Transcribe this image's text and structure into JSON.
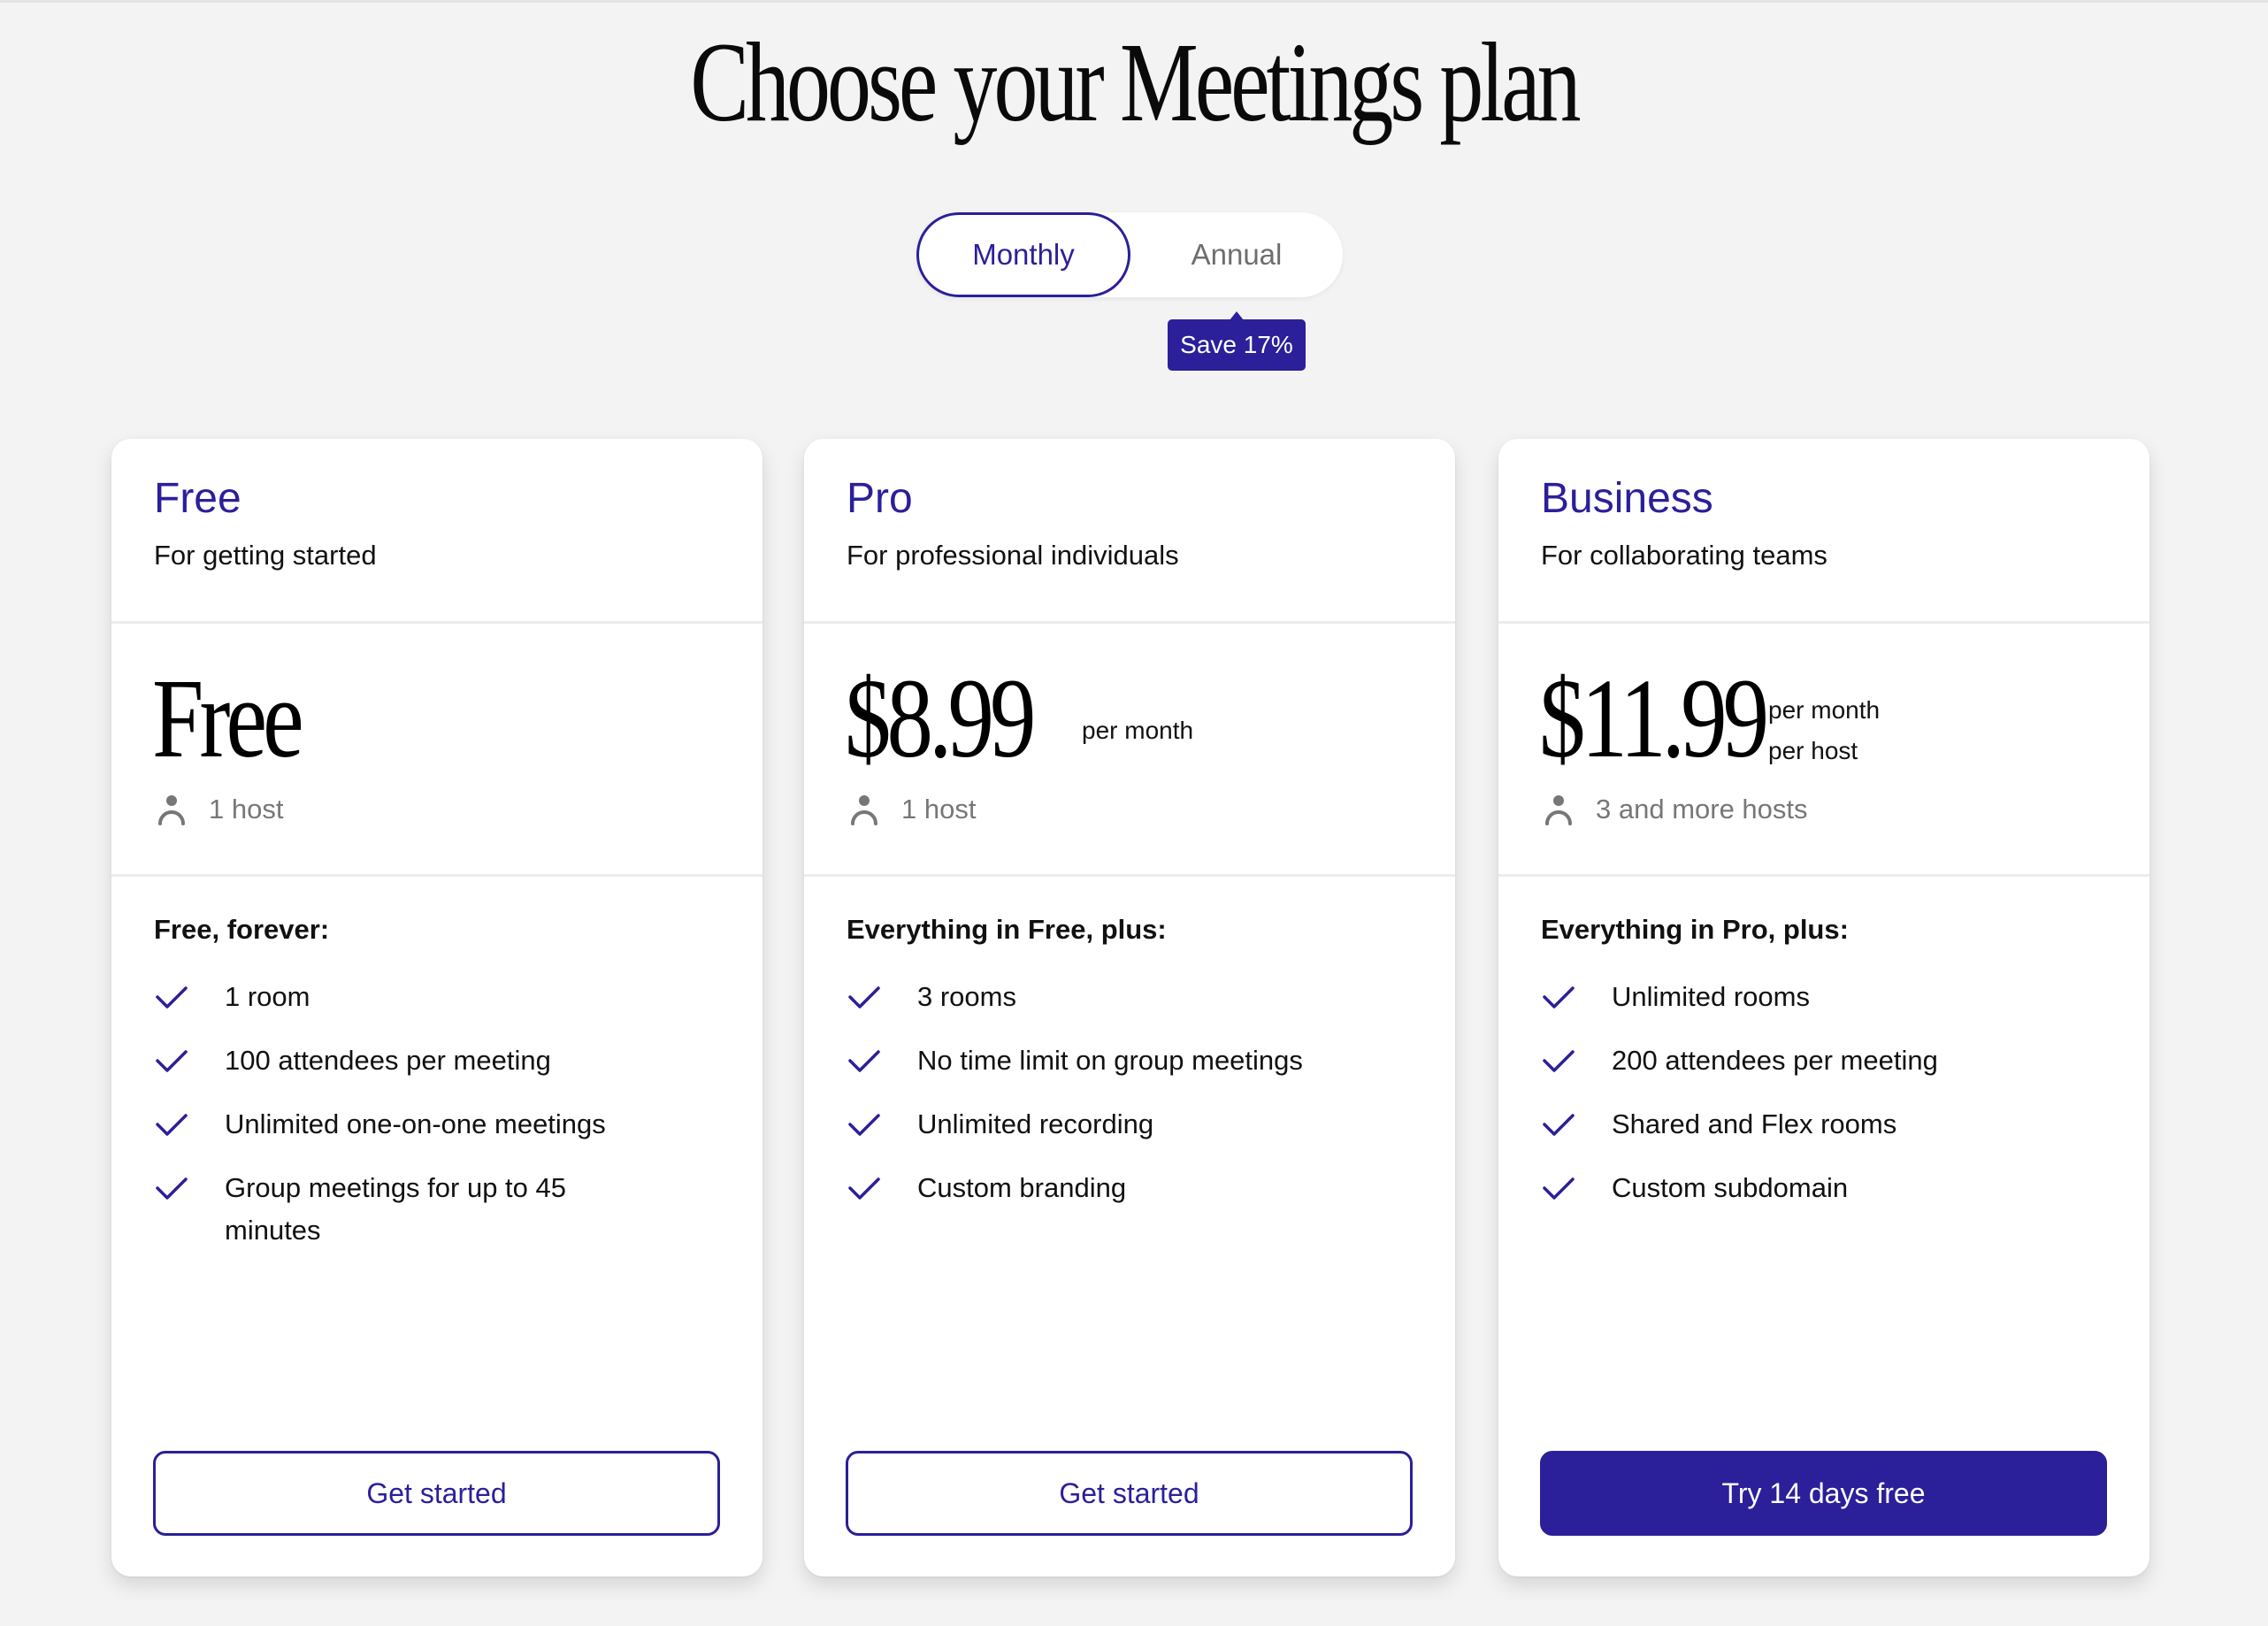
{
  "page": {
    "title": "Choose your Meetings plan"
  },
  "billing_toggle": {
    "options": [
      {
        "label": "Monthly",
        "selected": true
      },
      {
        "label": "Annual",
        "selected": false
      }
    ],
    "save_badge": "Save 17%"
  },
  "colors": {
    "accent": "#2b1f9a",
    "background": "#f3f3f3",
    "card": "#ffffff",
    "muted_text": "#777777"
  },
  "plans": [
    {
      "name": "Free",
      "tagline": "For getting started",
      "price": "Free",
      "price_period": [],
      "hosts_icon": "person-icon",
      "hosts": "1 host",
      "features_heading": "Free, forever:",
      "features": [
        "1 room",
        "100 attendees per meeting",
        "Unlimited one-on-one meetings",
        "Group meetings for up to 45 minutes"
      ],
      "cta": "Get started",
      "cta_style": "outline"
    },
    {
      "name": "Pro",
      "tagline": "For professional individuals",
      "price": "$8.99",
      "price_period": [
        "per month"
      ],
      "hosts_icon": "person-icon",
      "hosts": "1 host",
      "features_heading": "Everything in Free, plus:",
      "features": [
        "3 rooms",
        "No time limit on group meetings",
        "Unlimited recording",
        "Custom branding"
      ],
      "cta": "Get started",
      "cta_style": "outline"
    },
    {
      "name": "Business",
      "tagline": "For collaborating teams",
      "price": "$11.99",
      "price_period": [
        "per month",
        "per host"
      ],
      "hosts_icon": "person-icon",
      "hosts": "3 and more hosts",
      "features_heading": "Everything in Pro, plus:",
      "features": [
        "Unlimited rooms",
        "200 attendees per meeting",
        "Shared and Flex rooms",
        "Custom subdomain"
      ],
      "cta": "Try 14 days free",
      "cta_style": "filled"
    }
  ]
}
